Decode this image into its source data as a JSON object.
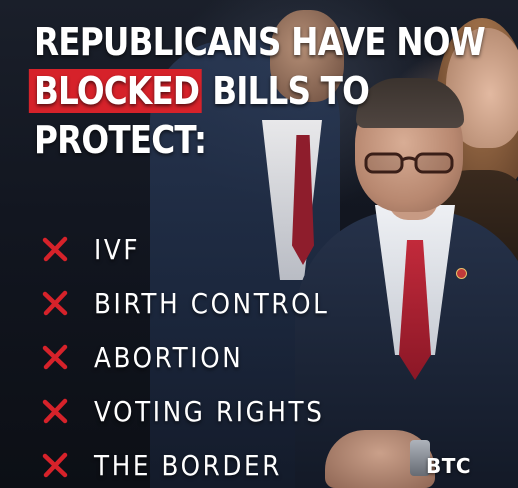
{
  "headline": {
    "line1": "REPUBLICANS HAVE NOW",
    "line2_highlight": "BLOCKED",
    "line2_rest": " BILLS TO",
    "line3": "PROTECT:"
  },
  "list_items": [
    {
      "icon": "red-x-icon",
      "label": "IVF"
    },
    {
      "icon": "red-x-icon",
      "label": "BIRTH CONTROL"
    },
    {
      "icon": "red-x-icon",
      "label": "ABORTION"
    },
    {
      "icon": "red-x-icon",
      "label": "VOTING RIGHTS"
    },
    {
      "icon": "red-x-icon",
      "label": "THE BORDER"
    }
  ],
  "logo_text": "BTC",
  "colors": {
    "highlight": "#d6222a",
    "x_mark": "#d6222a",
    "text": "#ffffff"
  }
}
